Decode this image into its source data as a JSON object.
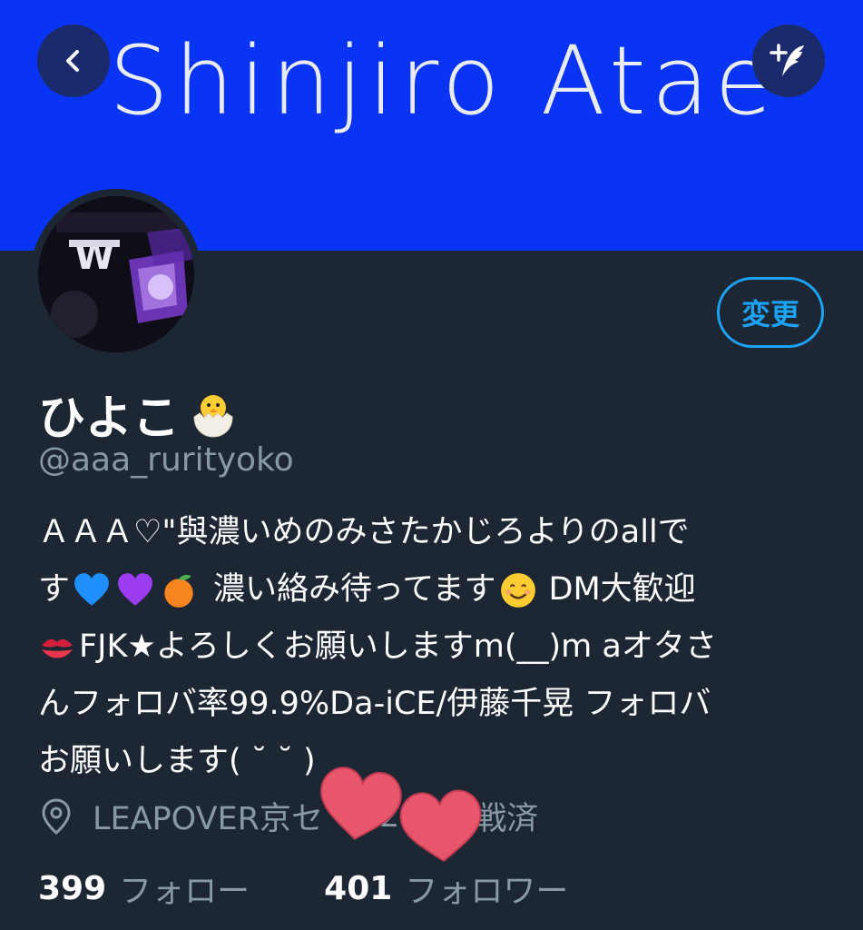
{
  "header": {
    "banner_text": "Shinjiro Atae",
    "banner_color": "#0a34f4"
  },
  "profile": {
    "name": "ひよこ",
    "handle": "@aaa_rurityoko",
    "edit_button_label": "変更",
    "bio_lines": [
      "ＡＡＡ♡\"與濃いめのみさたかじろよりのallで",
      "す",
      "濃い絡み待ってます",
      "DM大歓迎",
      "FJK★よろしくお願いしますm(__)m aオタさ",
      "んフォロバ率99.9%Da-iCE/伊藤千晃 フォロバ",
      "お願いします( ˘ ˘ )"
    ],
    "location": "LEAPOVER京セ",
    "location_tail": "2",
    "location_end": "参戦済",
    "following_count": "399",
    "following_label": "フォロー",
    "followers_count": "401",
    "followers_label": "フォロワー"
  },
  "colors": {
    "background": "#1c2733",
    "accent": "#1da1f2",
    "muted": "#8899a6",
    "heart": "#e8566b"
  },
  "icons": [
    "back-chevron-icon",
    "compose-tweet-icon",
    "location-pin-icon",
    "hatching-chick-emoji",
    "blue-heart-emoji",
    "purple-heart-emoji",
    "tangerine-emoji",
    "smiling-face-emoji",
    "kiss-mark-emoji",
    "heart-sticker"
  ]
}
